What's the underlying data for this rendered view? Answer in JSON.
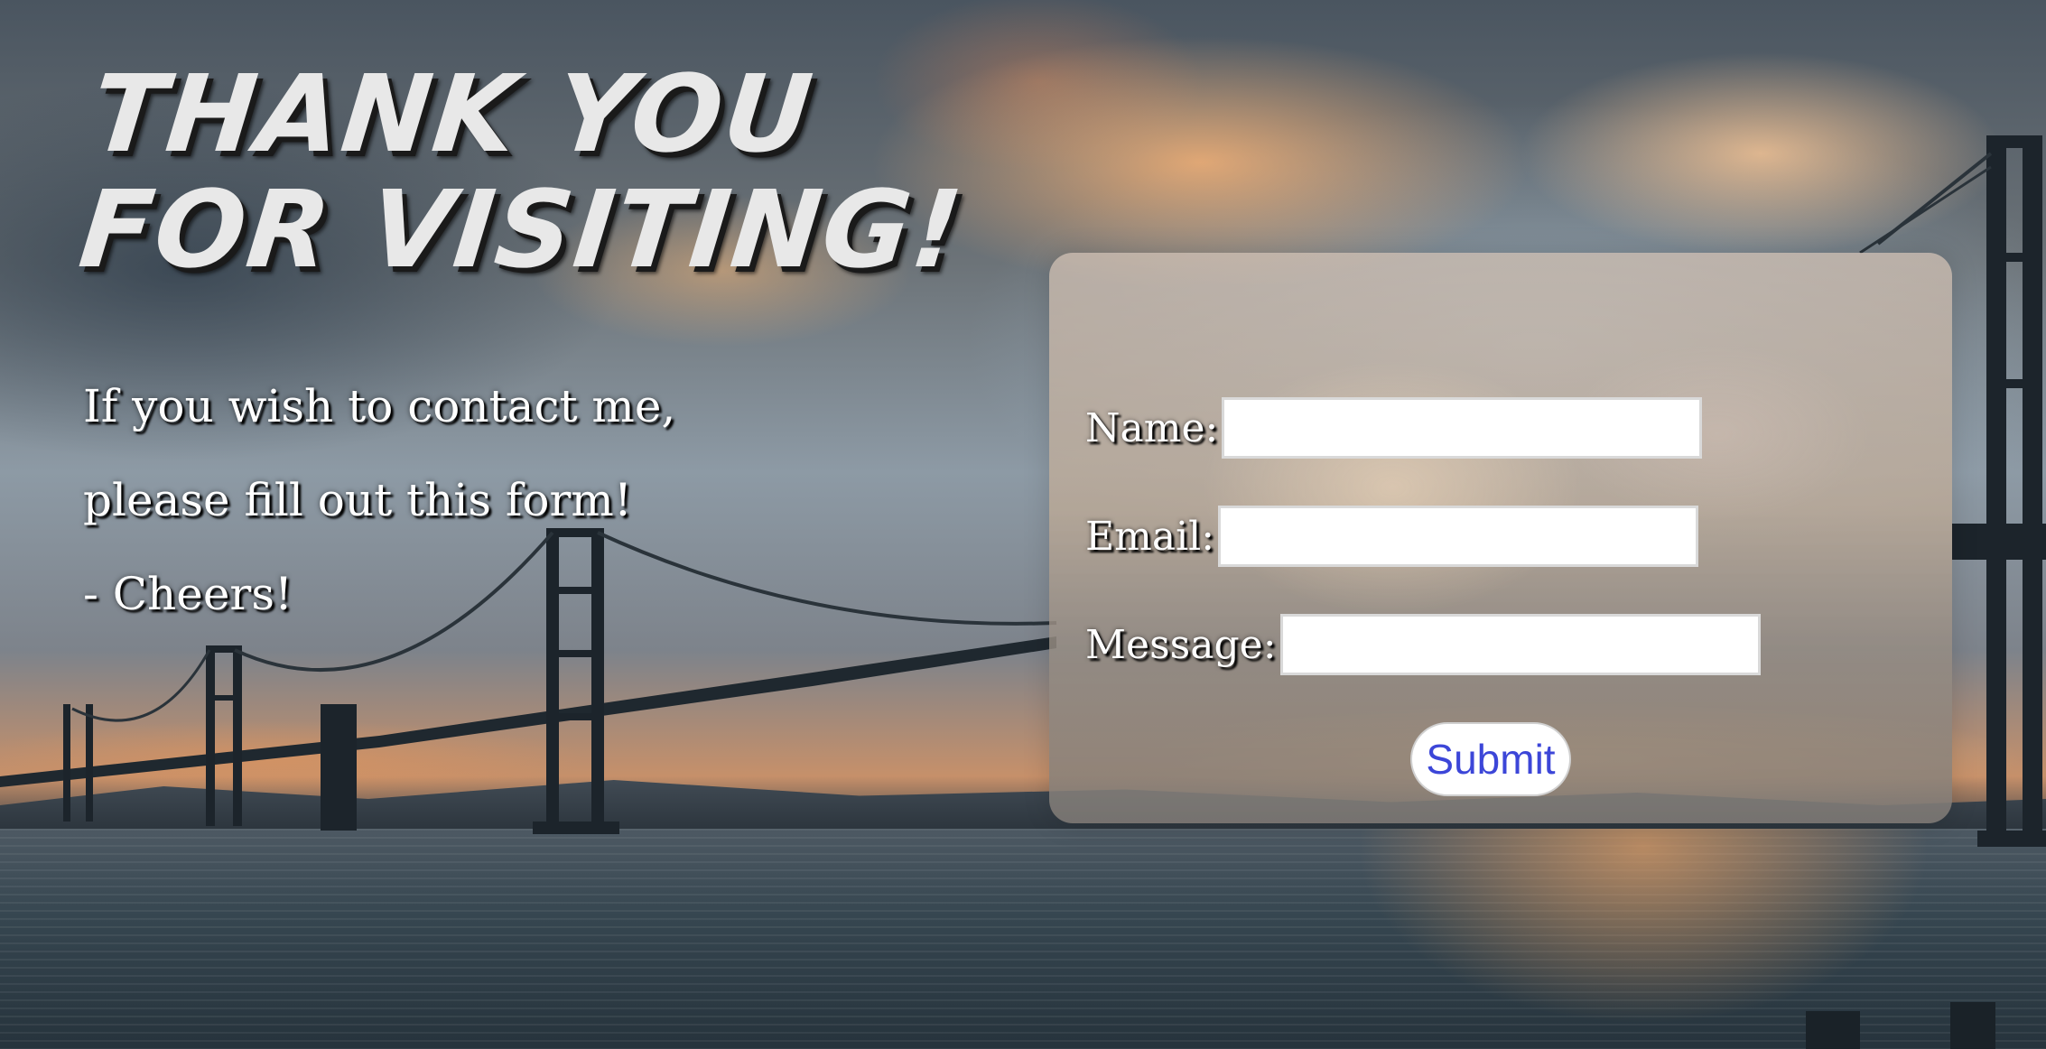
{
  "headline": {
    "line1": "Thank you",
    "line2": "for Visiting!"
  },
  "intro": {
    "line1": "If you wish to contact me,",
    "line2": "please fill out this form!",
    "line3": "- Cheers!"
  },
  "form": {
    "name_label": "Name:",
    "name_value": "",
    "email_label": "Email:",
    "email_value": "",
    "message_label": "Message:",
    "message_value": "",
    "submit_label": "Submit"
  },
  "colors": {
    "submit_text": "#3c46d8",
    "label_text": "#ffffff"
  }
}
